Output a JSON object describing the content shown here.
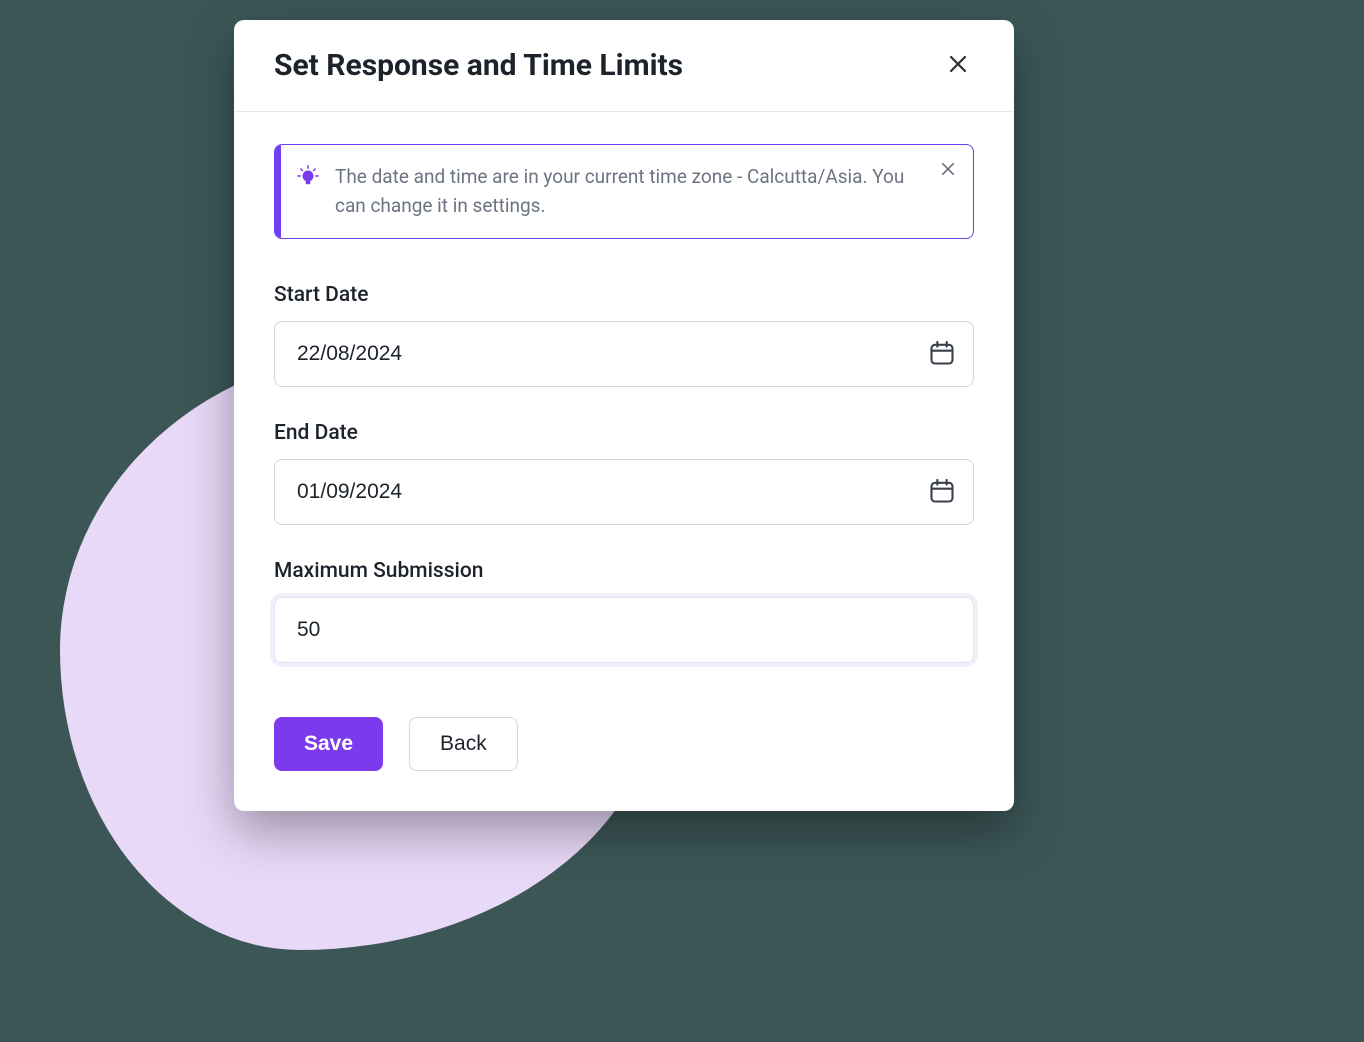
{
  "modal": {
    "title": "Set Response and Time Limits",
    "banner": {
      "text": "The date and time are in your current time zone - Calcutta/Asia. You can change it in settings."
    },
    "fields": {
      "start_date": {
        "label": "Start Date",
        "value": "22/08/2024"
      },
      "end_date": {
        "label": "End Date",
        "value": "01/09/2024"
      },
      "max_submission": {
        "label": "Maximum Submission",
        "value": "50"
      }
    },
    "actions": {
      "save_label": "Save",
      "back_label": "Back"
    }
  }
}
